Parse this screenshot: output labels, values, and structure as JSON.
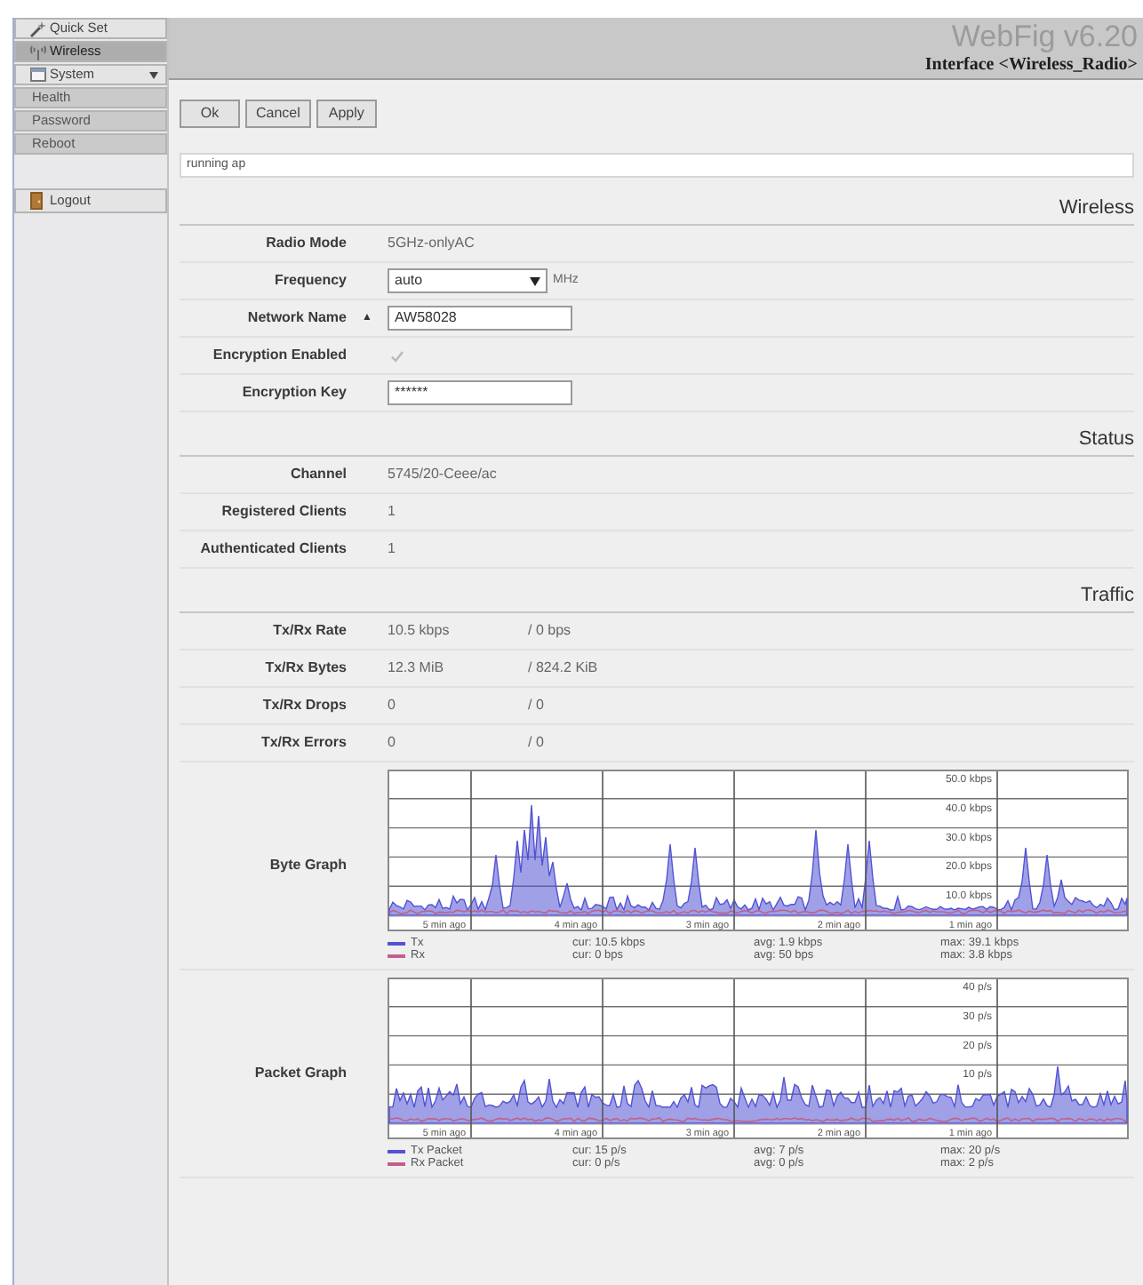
{
  "sidebar": {
    "items": [
      {
        "kind": "link",
        "label": "Quick Set",
        "selected": false
      },
      {
        "kind": "link",
        "label": "Wireless",
        "selected": true
      },
      {
        "kind": "group",
        "label": "System",
        "selected": false,
        "expanded": true,
        "children": [
          {
            "kind": "link",
            "label": "Health",
            "selected": false
          },
          {
            "kind": "link",
            "label": "Password",
            "selected": false
          },
          {
            "kind": "link",
            "label": "Reboot",
            "selected": false
          }
        ]
      }
    ],
    "logout": "Logout"
  },
  "header": {
    "brand": "WebFig v6.20",
    "title": "Interface <Wireless_Radio>"
  },
  "buttons": [
    "Ok",
    "Cancel",
    "Apply"
  ],
  "status_field": {
    "value": "running ap"
  },
  "sections": [
    {
      "title": "Wireless",
      "rows": [
        {
          "kind": "text",
          "label": "Radio Mode",
          "value": "5GHz-onlyAC"
        },
        {
          "kind": "select",
          "label": "Frequency",
          "value": "auto",
          "unit": "MHz"
        },
        {
          "kind": "input",
          "label": "Network Name",
          "toggle": "▲",
          "value": "AW58028"
        },
        {
          "kind": "checkbox",
          "label": "Encryption Enabled",
          "checked": true,
          "disabled": true
        },
        {
          "kind": "input",
          "label": "Encryption Key",
          "value": "******"
        }
      ]
    },
    {
      "title": "Status",
      "rows": [
        {
          "kind": "text",
          "label": "Channel",
          "value": "5745/20-Ceee/ac"
        },
        {
          "kind": "text",
          "label": "Registered Clients",
          "value": "1"
        },
        {
          "kind": "text",
          "label": "Authenticated Clients",
          "value": "1"
        }
      ]
    },
    {
      "title": "Traffic",
      "rows": [
        {
          "kind": "pair",
          "label": "Tx/Rx Rate",
          "tx": "10.5 kbps",
          "rx": "/ 0 bps"
        },
        {
          "kind": "pair",
          "label": "Tx/Rx Bytes",
          "tx": "12.3 MiB",
          "rx": "/ 824.2 KiB"
        },
        {
          "kind": "pair",
          "label": "Tx/Rx Drops",
          "tx": "0",
          "rx": "/ 0"
        },
        {
          "kind": "pair",
          "label": "Tx/Rx Errors",
          "tx": "0",
          "rx": "/ 0"
        },
        {
          "kind": "graph",
          "label": "Byte Graph",
          "y_labels": [
            "50.0 kbps",
            "40.0 kbps",
            "30.0 kbps",
            "20.0 kbps",
            "10.0 kbps"
          ],
          "x_labels": [
            "5 min ago",
            "4 min ago",
            "3 min ago",
            "2 min ago",
            "1 min ago"
          ],
          "legend": [
            {
              "name": "Tx",
              "color": "#5252d4",
              "cur": "cur: 10.5 kbps",
              "avg": "avg: 1.9 kbps",
              "max": "max: 39.1 kbps"
            },
            {
              "name": "Rx",
              "color": "#c0608a",
              "cur": "cur: 0 bps",
              "avg": "avg: 50 bps",
              "max": "max: 3.8 kbps"
            }
          ]
        },
        {
          "kind": "graph",
          "label": "Packet Graph",
          "y_labels": [
            "40 p/s",
            "30 p/s",
            "20 p/s",
            "10 p/s"
          ],
          "x_labels": [
            "5 min ago",
            "4 min ago",
            "3 min ago",
            "2 min ago",
            "1 min ago"
          ],
          "legend": [
            {
              "name": "Tx Packet",
              "color": "#5252d4",
              "cur": "cur: 15 p/s",
              "avg": "avg: 7 p/s",
              "max": "max: 20 p/s"
            },
            {
              "name": "Rx Packet",
              "color": "#c0608a",
              "cur": "cur: 0 p/s",
              "avg": "avg: 0 p/s",
              "max": "max: 2 p/s"
            }
          ]
        }
      ]
    }
  ]
}
